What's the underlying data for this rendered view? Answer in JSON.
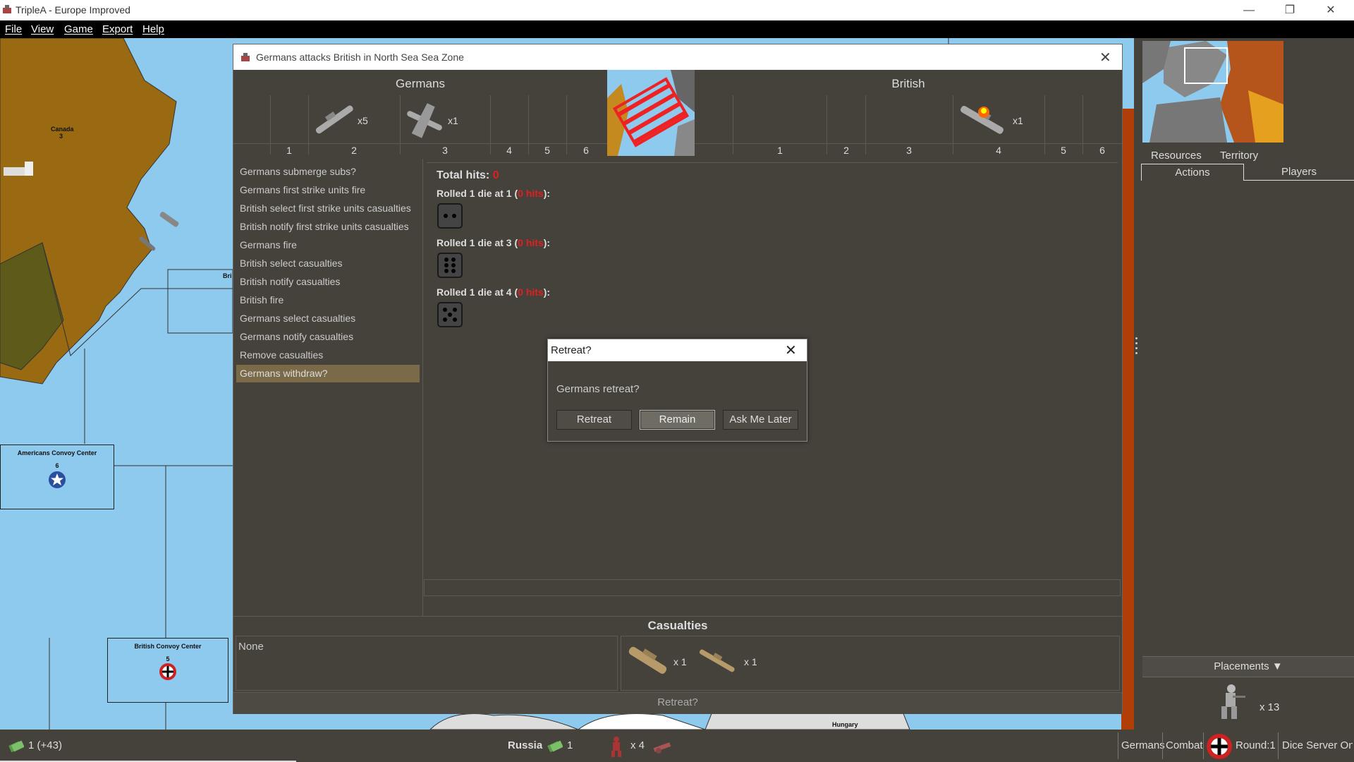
{
  "window": {
    "title": "TripleA - Europe Improved"
  },
  "menu": [
    "File",
    "View",
    "Game",
    "Export",
    "Help"
  ],
  "map": {
    "labels": {
      "canada": "Canada",
      "canada_value": "3",
      "british_partial": "Bri",
      "americans_convoy": "Americans Convoy Center",
      "americans_convoy_value": "6",
      "british_convoy": "British Convoy Center",
      "british_convoy_value": "5",
      "hungary": "Hungary"
    }
  },
  "battle": {
    "title": "Germans attacks British in North Sea Sea Zone",
    "attacker": "Germans",
    "defender": "British",
    "attacker_columns": [
      "1",
      "2",
      "3",
      "4",
      "5",
      "6"
    ],
    "defender_columns": [
      "1",
      "2",
      "3",
      "4",
      "5",
      "6"
    ],
    "attacker_units": [
      {
        "icon": "battleship-icon",
        "count": "x5"
      },
      {
        "icon": "fighter-plane-icon",
        "count": "x1"
      }
    ],
    "defender_units": [
      {
        "icon": "damaged-battleship-icon",
        "count": "x1"
      }
    ],
    "phases": [
      "Germans submerge subs?",
      "Germans first strike units fire",
      "British select first strike units casualties",
      "British notify first strike units casualties",
      "Germans fire",
      "British select casualties",
      "British notify casualties",
      "British fire",
      "Germans select casualties",
      "Germans notify casualties",
      "Remove casualties",
      "Germans withdraw?"
    ],
    "selected_phase_index": 11,
    "total_hits_label": "Total hits: ",
    "total_hits": "0",
    "rolls": [
      {
        "prefix": "Rolled 1 die at 1 (",
        "hits": "0 hits",
        "suffix": "):",
        "die": 2
      },
      {
        "prefix": "Rolled 1 die at 3 (",
        "hits": "0 hits",
        "suffix": "):",
        "die": 6
      },
      {
        "prefix": "Rolled 1 die at 4 (",
        "hits": "0 hits",
        "suffix": "):",
        "die": 5
      }
    ],
    "casualties_title": "Casualties",
    "casualties_attacker": "None",
    "casualties_defender_units": [
      {
        "icon": "transport-ship-icon",
        "count": "x 1"
      },
      {
        "icon": "destroyer-icon",
        "count": "x 1"
      }
    ],
    "status": "Retreat?"
  },
  "retreat_dialog": {
    "title": "Retreat?",
    "message": "Germans retreat?",
    "buttons": {
      "retreat": "Retreat",
      "remain": "Remain",
      "later": "Ask Me Later"
    }
  },
  "right_panel": {
    "tabs_top": [
      "Resources",
      "Territory"
    ],
    "tabs_bottom": [
      "Actions",
      "Players"
    ],
    "active_tab": "Actions",
    "placements_label": "Placements ▼",
    "placements_count": "x 13"
  },
  "statusbar": {
    "pus": "1 (+43)",
    "territory": "Russia",
    "territory_pus": "1",
    "units_count": "x 4",
    "player": "Germans",
    "phase": "Combat",
    "round": "Round:1",
    "dice": "Dice Server On"
  },
  "colors": {
    "panel": "#45413b",
    "sea": "#8ec9ee",
    "canada_land": "#9a6a12",
    "selected": "#7b6a48",
    "hits_red": "#e02020"
  }
}
